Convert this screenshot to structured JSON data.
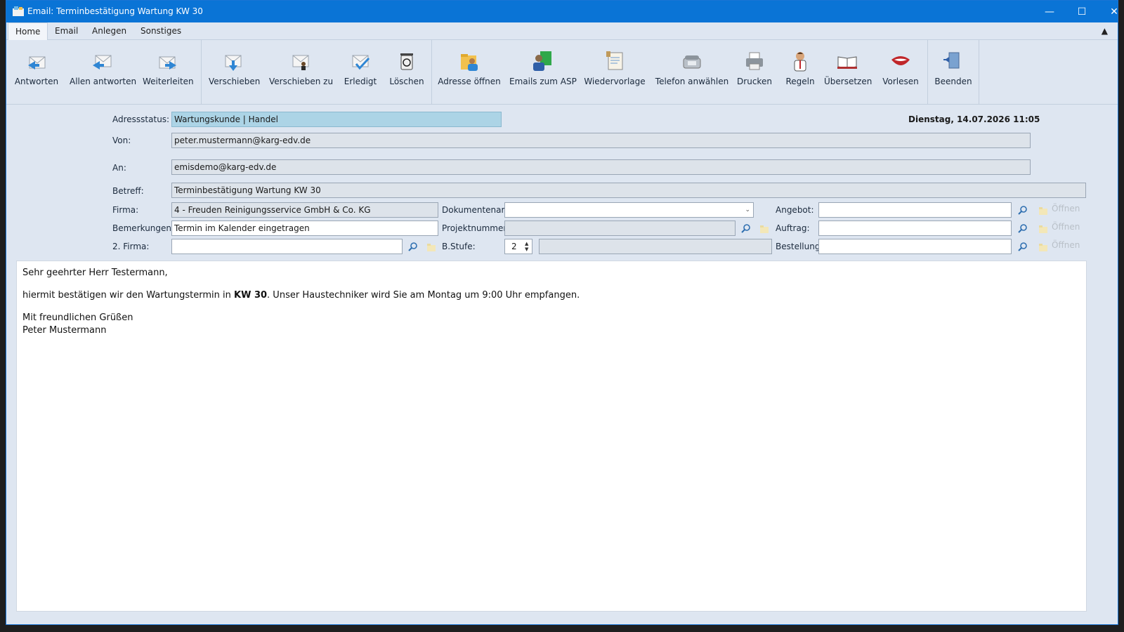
{
  "window": {
    "title": "Email: Terminbestätigung Wartung KW 30",
    "controls": {
      "minimize": "—",
      "maximize": "☐",
      "close": "✕"
    }
  },
  "menu": {
    "items": [
      "Home",
      "Email",
      "Anlegen",
      "Sonstiges"
    ],
    "active": "Home",
    "collapse_icon": "▲"
  },
  "ribbon": {
    "buttons": [
      {
        "label": "Antworten",
        "icon": "reply-icon"
      },
      {
        "label": "Allen antworten",
        "icon": "reply-all-icon"
      },
      {
        "label": "Weiterleiten",
        "icon": "forward-icon"
      },
      {
        "label": "Verschieben",
        "icon": "move-icon"
      },
      {
        "label": "Verschieben zu",
        "icon": "move-to-icon"
      },
      {
        "label": "Erledigt",
        "icon": "done-icon"
      },
      {
        "label": "Löschen",
        "icon": "trash-icon"
      },
      {
        "label": "Adresse öffnen",
        "icon": "address-icon"
      },
      {
        "label": "Emails zum ASP",
        "icon": "contacts-icon"
      },
      {
        "label": "Wiedervorlage",
        "icon": "calendar-icon"
      },
      {
        "label": "Telefon anwählen",
        "icon": "phone-icon"
      },
      {
        "label": "Drucken",
        "icon": "printer-icon"
      },
      {
        "label": "Regeln",
        "icon": "rules-icon"
      },
      {
        "label": "Übersetzen",
        "icon": "translate-icon"
      },
      {
        "label": "Vorlesen",
        "icon": "speak-icon"
      },
      {
        "label": "Beenden",
        "icon": "exit-icon"
      }
    ]
  },
  "form": {
    "adressstatus_label": "Adressstatus:",
    "adressstatus_value": "Wartungskunde | Handel",
    "datetime": "Dienstag, 14.07.2026 11:05",
    "von_label": "Von:",
    "von_value": "peter.mustermann@karg-edv.de",
    "an_label": "An:",
    "an_value": "emisdemo@karg-edv.de",
    "betreff_label": "Betreff:",
    "betreff_value": "Terminbestätigung Wartung KW 30",
    "firma_label": "Firma:",
    "firma_value": "4 - Freuden Reinigungsservice GmbH & Co. KG",
    "bemerkungen_label": "Bemerkungen:",
    "bemerkungen_value": "Termin im Kalender eingetragen",
    "firma2_label": "2. Firma:",
    "firma2_value": "",
    "dokumentenart_label": "Dokumentenart:",
    "dokumentenart_value": "",
    "projektnummer_label": "Projektnummer:",
    "projektnummer_value": "",
    "bstufe_label": "B.Stufe:",
    "bstufe_value": "2",
    "bstufe_desc": "",
    "angebot_label": "Angebot:",
    "angebot_value": "",
    "auftrag_label": "Auftrag:",
    "auftrag_value": "",
    "bestellung_label": "Bestellung:",
    "bestellung_value": "",
    "open_label": "Öffnen"
  },
  "body": {
    "greeting": "Sehr geehrter Herr Testermann,",
    "line1_pre": "hiermit bestätigen wir den Wartungstermin in ",
    "line1_bold": "KW 30",
    "line1_post": ". Unser Haustechniker wird Sie am Montag um 9:00 Uhr empfangen.",
    "closing": "Mit freundlichen Grüßen",
    "signature": "Peter Mustermann"
  }
}
